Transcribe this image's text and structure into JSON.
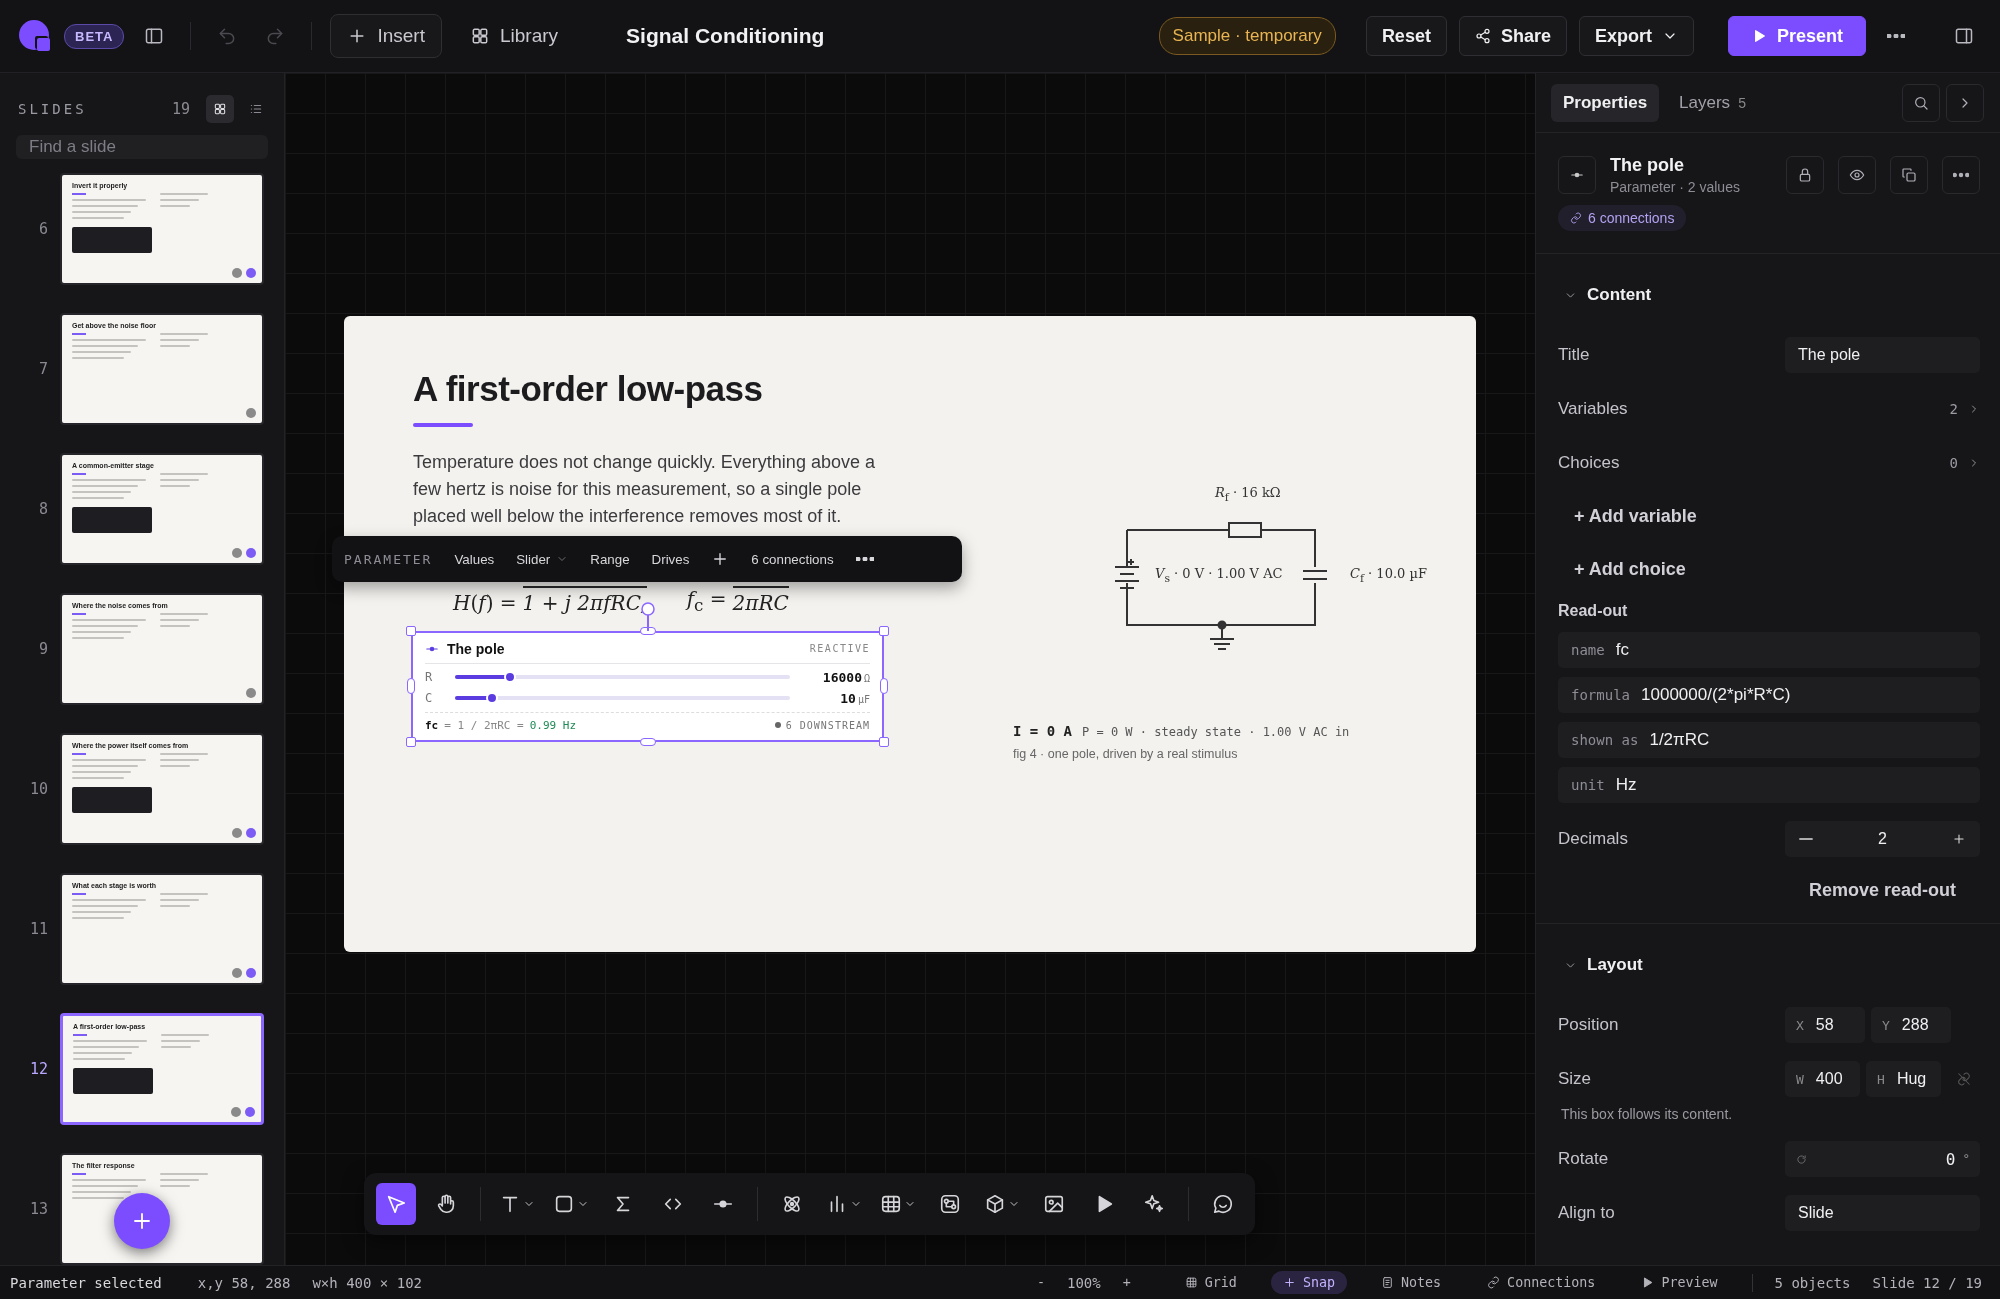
{
  "topbar": {
    "badge": "BETA",
    "history": [
      {
        "kind": "undo",
        "disabled": true
      },
      {
        "kind": "redo",
        "disabled": true
      }
    ],
    "insert_button": "Insert",
    "library_button": "Library",
    "document_title": "Signal Conditioning",
    "status_pill": "Sample · temporary",
    "actions": [
      {
        "kind": "plain",
        "label": "Reset"
      },
      {
        "kind": "share",
        "label": "Share"
      },
      {
        "kind": "dropdown",
        "label": "Export"
      },
      {
        "kind": "primary",
        "label": "Present"
      }
    ]
  },
  "sidebar": {
    "heading": "SLIDES",
    "count": "19",
    "view_modes": [
      {
        "kind": "grid",
        "selected": true
      },
      {
        "kind": "list",
        "selected": false
      }
    ],
    "search": {
      "placeholder": "Find a slide"
    },
    "slides": [
      {
        "number": "6",
        "title": "Invert it properly",
        "selected": false,
        "dots": [
          {
            "color": "#8a8a8a"
          },
          {
            "color": "#7c5cf5"
          }
        ]
      },
      {
        "number": "7",
        "title": "Get above the noise floor",
        "selected": false,
        "dots": [
          {
            "color": "#8a8a8a"
          }
        ]
      },
      {
        "number": "8",
        "title": "A common-emitter stage",
        "selected": false,
        "dots": [
          {
            "color": "#8a8a8a"
          },
          {
            "color": "#7c5cf5"
          }
        ]
      },
      {
        "number": "9",
        "title": "Where the noise comes from",
        "selected": false,
        "dots": [
          {
            "color": "#8a8a8a"
          }
        ]
      },
      {
        "number": "10",
        "title": "Where the power itself comes from",
        "selected": false,
        "dots": [
          {
            "color": "#8a8a8a"
          },
          {
            "color": "#7c5cf5"
          }
        ]
      },
      {
        "number": "11",
        "title": "What each stage is worth",
        "selected": false,
        "dots": [
          {
            "color": "#8a8a8a"
          },
          {
            "color": "#7c5cf5"
          }
        ]
      },
      {
        "number": "12",
        "title": "A first-order low-pass",
        "selected": true,
        "dots": [
          {
            "color": "#8a8a8a"
          },
          {
            "color": "#7c5cf5"
          }
        ]
      },
      {
        "number": "13",
        "title": "The filter response",
        "selected": false
      }
    ]
  },
  "slide": {
    "title": "A first-order low-pass",
    "body": "Temperature does not change quickly. Everything above a few hertz is noise for this measurement, so a single pole placed well below the interference removes most of it.",
    "formulas": [
      {
        "lhs": "*H*(*f*) =",
        "denominator": "1 + j 2πfRC,"
      },
      {
        "lhs": "*f*$_{c}$ =",
        "denominator": "2πRC"
      }
    ],
    "toolbar": {
      "type_label": "PARAMETER",
      "items": [
        {
          "kind": "text",
          "label": "Values"
        },
        {
          "kind": "dropdown",
          "label": "Slider"
        },
        {
          "kind": "text",
          "label": "Range"
        },
        {
          "kind": "text",
          "label": "Drives"
        },
        {
          "kind": "add"
        },
        {
          "kind": "text",
          "label": "6 connections"
        },
        {
          "kind": "more"
        }
      ]
    },
    "widget": {
      "title": "The pole",
      "tag": "REACTIVE",
      "variables": [
        {
          "name": "R",
          "value": "16000",
          "unit": "Ω",
          "level": 0.165
        },
        {
          "name": "C",
          "value": "10",
          "unit": "µF",
          "level": 0.11
        }
      ],
      "readout_name": "fc",
      "readout_formula": "= 1 / 2πRC =",
      "readout_value": "0.99 Hz",
      "downstream": "6 DOWNSTREAM"
    },
    "circuit": {
      "resistor_label": "*R*$_{f}$ · 16 kΩ",
      "source_label": "*V*$_{s}$ · 0 V · 1.00 V AC",
      "capacitor_label": "*C*$_{f}$ · 10.0 µF"
    },
    "reading_current": "I = 0 A",
    "reading_rest": "P = 0 W · steady state · 1.00 V AC in",
    "caption": "fig 4 · one pole, driven by a real stimulus"
  },
  "tool_groups": [
    {
      "tools": [
        {
          "kind": "pointer",
          "selected": true,
          "menu": false
        },
        {
          "kind": "hand",
          "selected": false,
          "menu": false
        }
      ]
    },
    {
      "tools": [
        {
          "kind": "text",
          "selected": false,
          "menu": true
        },
        {
          "kind": "shape",
          "selected": false,
          "menu": true
        },
        {
          "kind": "sigma",
          "selected": false,
          "menu": false
        },
        {
          "kind": "code",
          "selected": false,
          "menu": false
        },
        {
          "kind": "param",
          "selected": false,
          "menu": false
        }
      ]
    },
    {
      "tools": [
        {
          "kind": "atom",
          "selected": false,
          "menu": false
        },
        {
          "kind": "chart",
          "selected": false,
          "menu": true
        },
        {
          "kind": "table",
          "selected": false,
          "menu": true
        },
        {
          "kind": "diagram",
          "selected": false,
          "menu": false
        },
        {
          "kind": "cube",
          "selected": false,
          "menu": true
        },
        {
          "kind": "image",
          "selected": false,
          "menu": false
        },
        {
          "kind": "play",
          "selected": false,
          "menu": false
        },
        {
          "kind": "sparkle",
          "selected": false,
          "menu": false
        }
      ]
    },
    {
      "tools": [
        {
          "kind": "comment",
          "selected": false,
          "menu": false
        }
      ]
    }
  ],
  "panel": {
    "tabs": [
      {
        "label": "Properties",
        "selected": true
      },
      {
        "label": "Layers",
        "count": "5",
        "selected": false
      }
    ],
    "object": {
      "name": "The pole",
      "subtitle": "Parameter · 2 values",
      "connections": "6 connections"
    },
    "content": {
      "heading": "Content",
      "expanded": true,
      "title_label": "Title",
      "title_value": "The pole",
      "counts": [
        {
          "label": "Variables",
          "value": "2"
        },
        {
          "label": "Choices",
          "value": "0"
        }
      ],
      "add_actions": [
        "+ Add variable",
        "+ Add choice"
      ],
      "readout_heading": "Read-out",
      "readout_fields": [
        {
          "key": "name",
          "value": "fc"
        },
        {
          "key": "formula",
          "value": "1000000/(2*pi*R*C)"
        },
        {
          "key": "shown as",
          "value": "1/2πRC"
        },
        {
          "key": "unit",
          "value": "Hz"
        }
      ],
      "decimals_label": "Decimals",
      "decimals_value": "2",
      "remove_button": "Remove read-out"
    },
    "layout": {
      "heading": "Layout",
      "expanded": true,
      "position_label": "Position",
      "position": [
        {
          "prefix": "X",
          "value": "58"
        },
        {
          "prefix": "Y",
          "value": "288"
        }
      ],
      "size_label": "Size",
      "size": [
        {
          "prefix": "W",
          "value": "400"
        },
        {
          "prefix": "H",
          "value": "Hug"
        }
      ],
      "size_note": "This box follows its content.",
      "rotate_label": "Rotate",
      "rotate_value": "0",
      "rotate_unit": "°",
      "align_label": "Align to",
      "align_value": "Slide"
    }
  },
  "status_bar": {
    "selection": "Parameter selected",
    "position": "x,y 58, 288",
    "size": "w×h 400 × 102",
    "zoom_out": "-",
    "zoom": "100%",
    "zoom_in": "+",
    "toggles": [
      {
        "kind": "grid",
        "label": "Grid",
        "on": false
      },
      {
        "kind": "snap",
        "label": "Snap",
        "on": true
      },
      {
        "kind": "notes",
        "label": "Notes",
        "on": false
      },
      {
        "kind": "link",
        "label": "Connections",
        "on": false
      },
      {
        "kind": "play",
        "label": "Preview",
        "on": false
      }
    ],
    "objects": "5 objects",
    "slide_position": "Slide 12 / 19"
  }
}
